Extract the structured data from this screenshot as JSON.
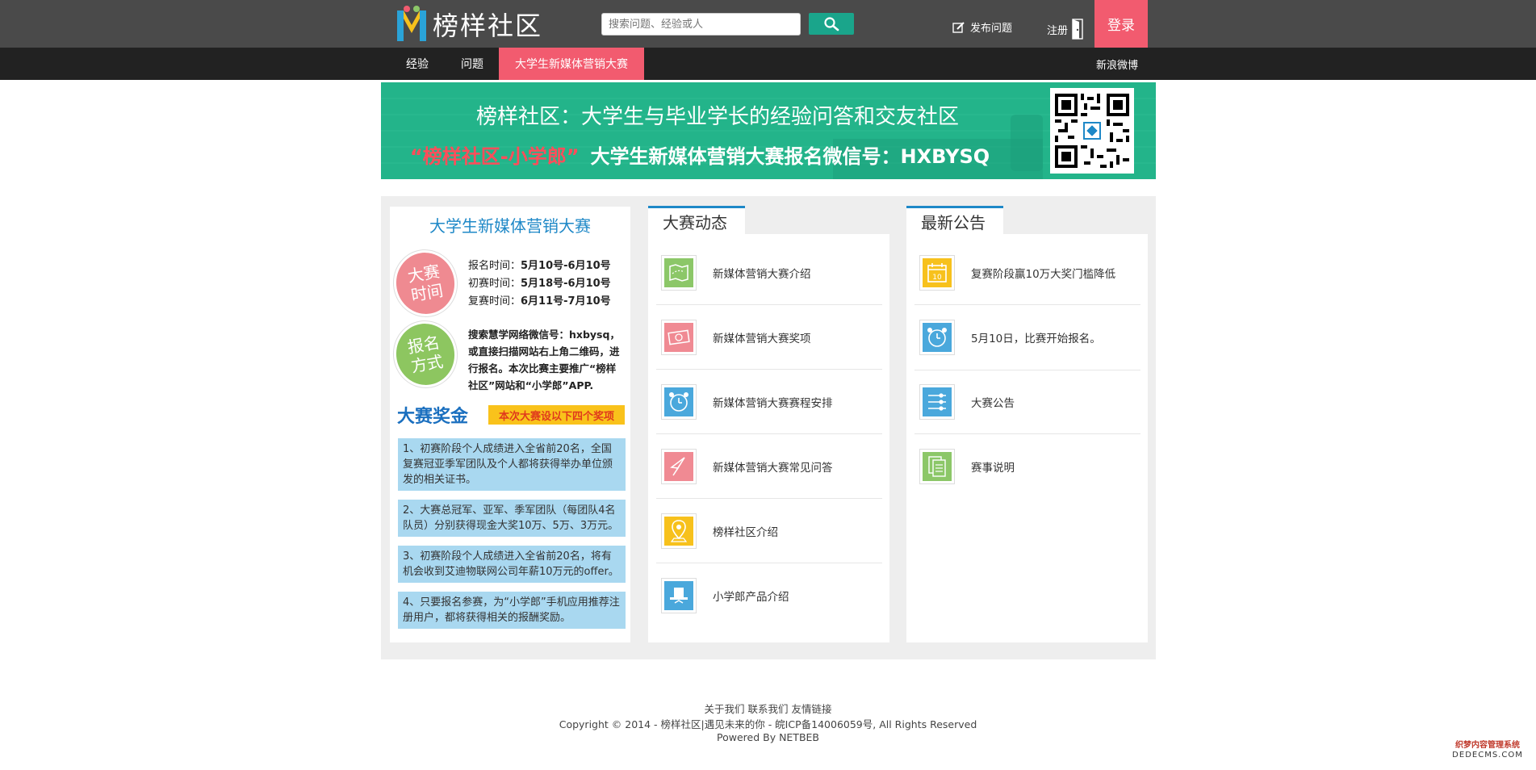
{
  "header": {
    "site_name": "榜样社区",
    "search_placeholder": "搜索问题、经验或人",
    "post_question": "发布问题",
    "register": "注册",
    "login": "登录",
    "colors": {
      "topbar": "#4a4a4a",
      "accent": "#f25b6f",
      "search_button": "#1aa58b"
    }
  },
  "nav": {
    "items": [
      {
        "label": "经验"
      },
      {
        "label": "问题"
      },
      {
        "label": "大学生新媒体营销大赛"
      }
    ],
    "weibo": "新浪微博"
  },
  "banner": {
    "title": "榜样社区：大学生与毕业学长的经验问答和交友社区",
    "subtitle_red": "“榜样社区-小学郎”",
    "subtitle_white": "大学生新媒体营销大赛报名微信号：HXBYSQ"
  },
  "contest": {
    "title": "大学生新媒体营销大赛",
    "time_badge": "大赛时间",
    "signup_badge": "报名方式",
    "dates": [
      {
        "label": "报名时间：",
        "value": "5月10号-6月10号"
      },
      {
        "label": "初赛时间：",
        "value": "5月18号-6月10号"
      },
      {
        "label": "复赛时间：",
        "value": "6月11号-7月10号"
      }
    ],
    "signup_text": "搜索慧学网络微信号：hxbysq，或直接扫描网站右上角二维码，进行报名。本次比赛主要推广“榜样社区”网站和“小学郎”APP.",
    "prize_heading": "大赛奖金",
    "prize_tag": "本次大赛设以下四个奖项",
    "prizes": [
      "1、初赛阶段个人成绩进入全省前20名，全国复赛冠亚季军团队及个人都将获得举办单位颁发的相关证书。",
      "2、大赛总冠军、亚军、季军团队（每团队4名队员）分别获得现金大奖10万、5万、3万元。",
      "3、初赛阶段个人成绩进入全省前20名，将有机会收到艾迪物联网公司年薪10万元的offer。",
      "4、只要报名参赛，为“小学郎”手机应用推荐注册用户，都将获得相关的报酬奖励。"
    ]
  },
  "news": {
    "title": "大赛动态",
    "items": [
      {
        "label": "新媒体营销大赛介绍",
        "icon": "map-icon",
        "color": "#8cc768"
      },
      {
        "label": "新媒体营销大赛奖项",
        "icon": "money-icon",
        "color": "#f08a93"
      },
      {
        "label": "新媒体营销大赛赛程安排",
        "icon": "alarm-clock-icon",
        "color": "#4aa8dc"
      },
      {
        "label": "新媒体营销大赛常见问答",
        "icon": "paper-plane-icon",
        "color": "#f08a93"
      },
      {
        "label": "榜样社区介绍",
        "icon": "location-pin-icon",
        "color": "#f7c11c"
      },
      {
        "label": "小学郎产品介绍",
        "icon": "top-hat-icon",
        "color": "#4aa8dc"
      }
    ]
  },
  "notices": {
    "title": "最新公告",
    "items": [
      {
        "label": "复赛阶段赢10万大奖门槛降低",
        "icon": "calendar-icon",
        "color": "#f7c11c",
        "badge": "10"
      },
      {
        "label": "5月10日，比赛开始报名。",
        "icon": "alarm-clock-icon",
        "color": "#4aa8dc"
      },
      {
        "label": "大赛公告",
        "icon": "settings-list-icon",
        "color": "#4aa8dc"
      },
      {
        "label": "赛事说明",
        "icon": "documents-icon",
        "color": "#8cc768"
      }
    ]
  },
  "footer": {
    "links": "关于我们 联系我们 友情链接",
    "copyright": "Copyright © 2014 - 榜样社区|遇见未来的你 - 皖ICP备14006059号, All Rights Reserved",
    "powered": "Powered By NETBEB"
  },
  "watermark": {
    "line1": "织梦内容管理系统",
    "line2": "DEDECMS.COM"
  }
}
